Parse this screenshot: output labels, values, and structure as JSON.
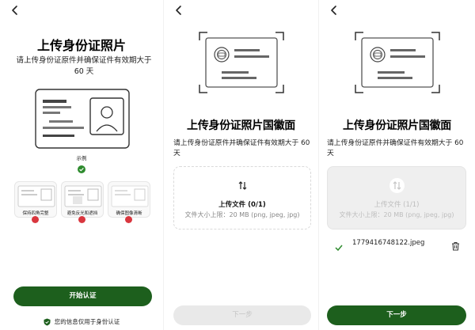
{
  "screen1": {
    "title": "上传身份证照片",
    "subtitle": "请上传身份证原件并确保证件有效期大于 60 天",
    "example_label": "示例",
    "tips": [
      {
        "label": "保持四角完整"
      },
      {
        "label": "避免反光和遮挡"
      },
      {
        "label": "确保图像清晰"
      }
    ],
    "start_button": "开始认证",
    "privacy_note": "您的信息仅用于身份认证",
    "colors": {
      "accent": "#1d5f1d",
      "error": "#d9363e",
      "check": "#2e8b2e"
    }
  },
  "screen2": {
    "title": "上传身份证照片国徽面",
    "subtitle": "请上传身份证原件并确保证件有效期大于 60 天",
    "upload_label": "上传文件 (0/1)",
    "upload_hint": "文件大小上限：20 MB (png, jpeg, jpg)",
    "next_button": "下一步"
  },
  "screen3": {
    "title": "上传身份证照片国徽面",
    "subtitle": "请上传身份证原件并确保证件有效期大于 60 天",
    "upload_label": "上传文件 (1/1)",
    "upload_hint": "文件大小上限：20 MB (png, jpeg, jpg)",
    "file_name": "1779416748122.jpeg",
    "next_button": "下一步"
  }
}
